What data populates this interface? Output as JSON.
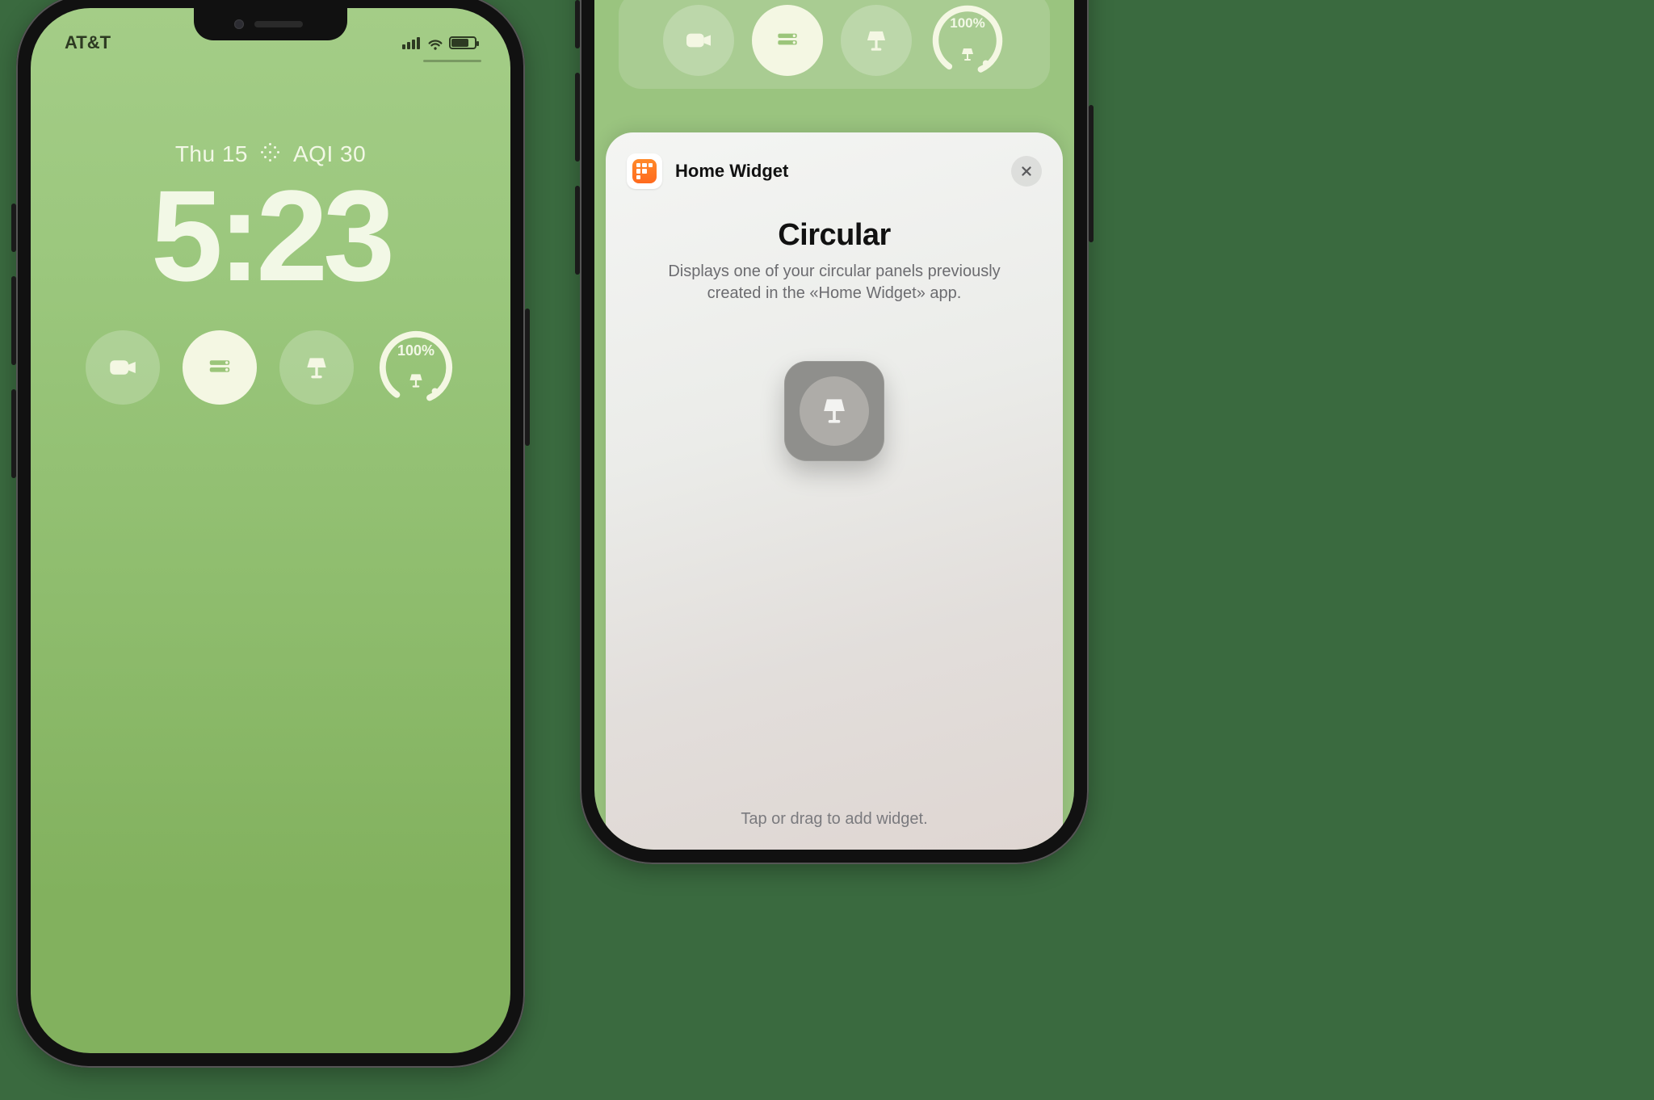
{
  "left": {
    "status": {
      "carrier": "AT&T"
    },
    "date": {
      "day": "Thu 15",
      "aqi": "AQI 30"
    },
    "time": "5:23",
    "widgets": {
      "gauge_value": "100%"
    }
  },
  "right": {
    "top_strip": {
      "gauge_value": "100%"
    },
    "sheet": {
      "app_name": "Home Widget",
      "heading": "Circular",
      "description": "Displays one of your circular panels previously created in the «Home Widget» app.",
      "footer": "Tap or drag to add widget."
    }
  }
}
